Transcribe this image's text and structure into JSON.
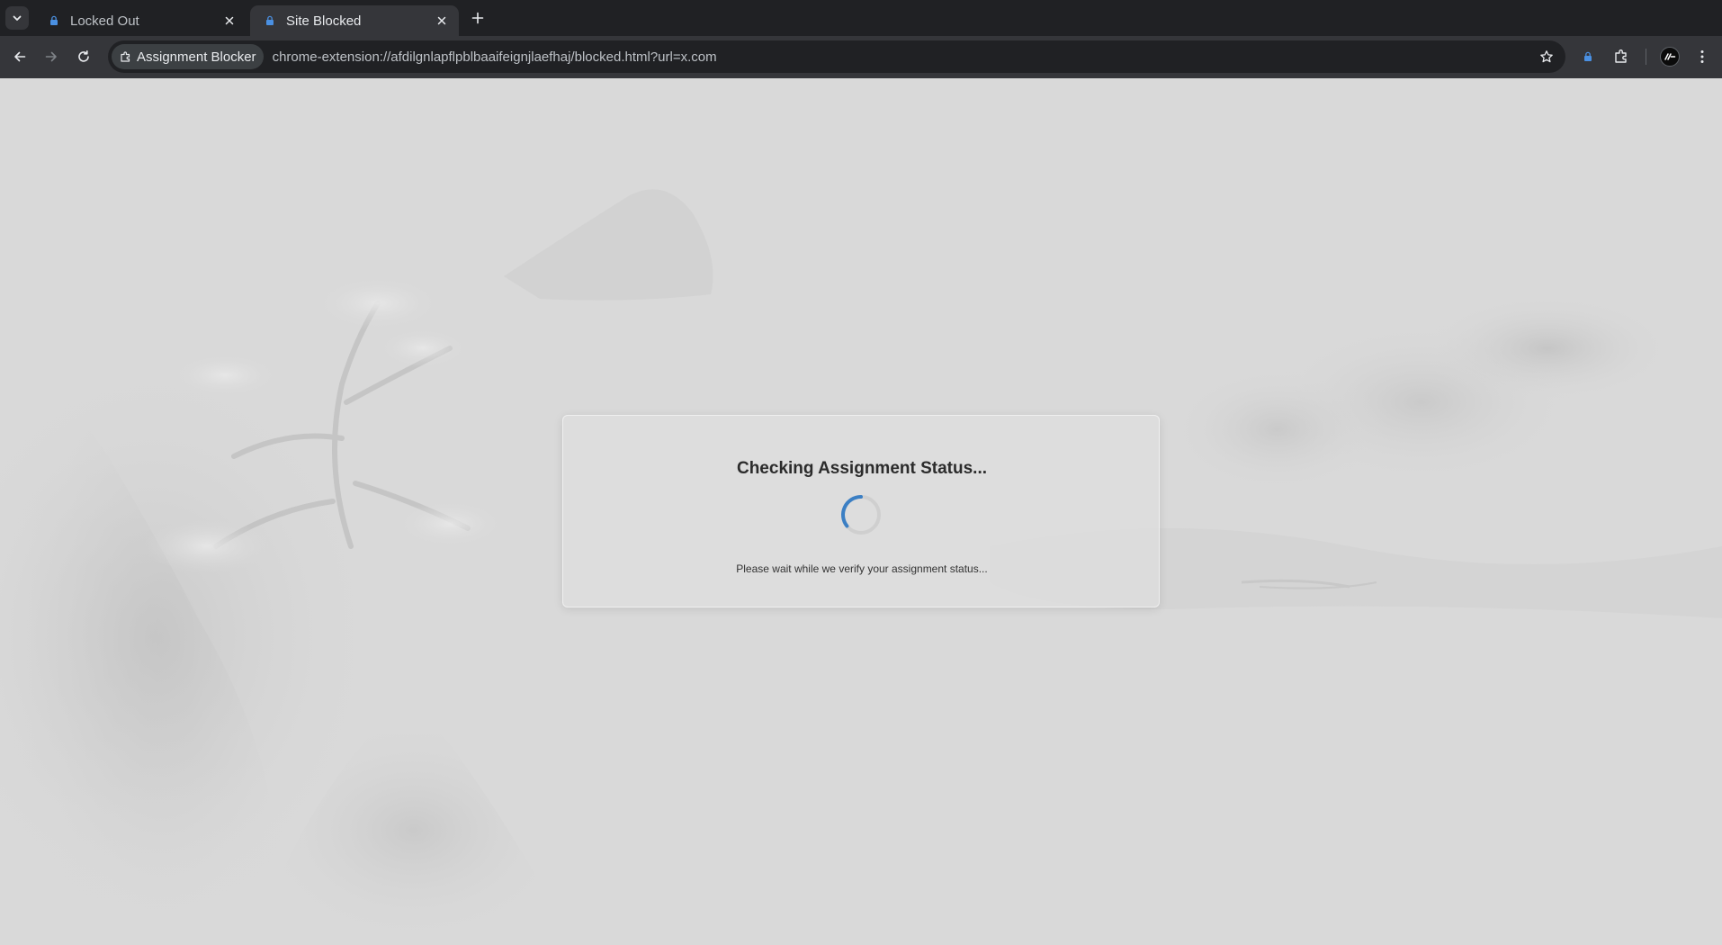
{
  "tabs": [
    {
      "title": "Locked Out",
      "favicon": "lock-icon",
      "active": false
    },
    {
      "title": "Site Blocked",
      "favicon": "lock-icon",
      "active": true
    }
  ],
  "toolbar": {
    "site_chip_label": "Assignment Blocker",
    "url": "chrome-extension://afdilgnlapflpblbaaifeignjlaefhaj/blocked.html?url=x.com"
  },
  "card": {
    "title": "Checking Assignment Status...",
    "message": "Please wait while we verify your assignment status..."
  },
  "colors": {
    "accent": "#1a73e8",
    "spinner": "#3b7fc4",
    "tabstrip_bg": "#202124",
    "toolbar_bg": "#35363a",
    "page_bg": "#d9d9d9"
  }
}
